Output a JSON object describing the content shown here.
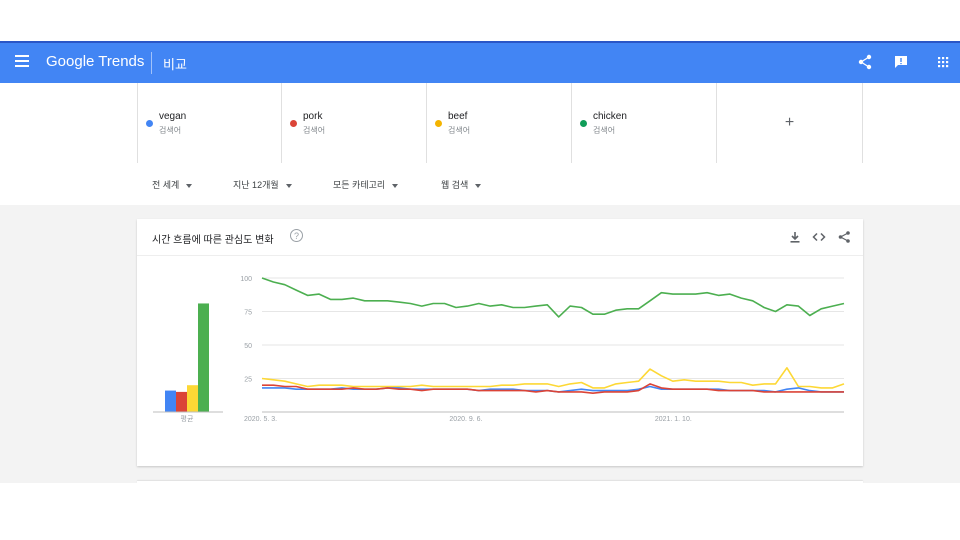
{
  "header": {
    "logo": "Google Trends",
    "title": "비교",
    "brand_color": "#4285f4",
    "icons": [
      "menu-icon",
      "share-icon",
      "feedback-icon",
      "apps-icon"
    ]
  },
  "terms": [
    {
      "name": "vegan",
      "type": "검색어",
      "color": "#4285f4"
    },
    {
      "name": "pork",
      "type": "검색어",
      "color": "#db4437"
    },
    {
      "name": "beef",
      "type": "검색어",
      "color": "#f4b400"
    },
    {
      "name": "chicken",
      "type": "검색어",
      "color": "#0f9d58"
    }
  ],
  "add_term": "+",
  "filters": {
    "region": "전 세계",
    "period": "지난 12개월",
    "category": "모든 카테고리",
    "search_type": "웹 검색"
  },
  "card": {
    "title": "시간 흐름에 따른 관심도 변화",
    "help": "?",
    "icons": [
      "download-icon",
      "embed-icon",
      "share-icon"
    ]
  },
  "chart_data": {
    "type": "line",
    "x_ticks": [
      "2020. 5. 3.",
      "2020. 9. 6.",
      "2021. 1. 10."
    ],
    "y_ticks": [
      "100",
      "75",
      "50",
      "25"
    ],
    "ylim": [
      0,
      100
    ],
    "grid": true,
    "average_label": "평균",
    "averages": [
      {
        "name": "vegan",
        "value": 16
      },
      {
        "name": "pork",
        "value": 15
      },
      {
        "name": "beef",
        "value": 20
      },
      {
        "name": "chicken",
        "value": 81
      }
    ],
    "series": [
      {
        "name": "chicken",
        "color": "#4caf50",
        "values": [
          100,
          97,
          95,
          91,
          87,
          88,
          84,
          84,
          85,
          83,
          83,
          83,
          82,
          81,
          79,
          81,
          81,
          78,
          79,
          81,
          79,
          80,
          78,
          78,
          79,
          80,
          71,
          79,
          78,
          73,
          73,
          76,
          77,
          77,
          83,
          89,
          88,
          88,
          88,
          89,
          87,
          88,
          85,
          83,
          78,
          75,
          80,
          79,
          72,
          77,
          79,
          81
        ]
      },
      {
        "name": "beef",
        "color": "#fdd835",
        "values": [
          25,
          24,
          23,
          21,
          19,
          20,
          20,
          20,
          19,
          19,
          19,
          19,
          19,
          19,
          20,
          19,
          19,
          19,
          19,
          19,
          19,
          20,
          20,
          21,
          21,
          21,
          19,
          21,
          22,
          18,
          18,
          21,
          22,
          23,
          32,
          27,
          23,
          24,
          23,
          23,
          23,
          22,
          22,
          20,
          21,
          21,
          33,
          19,
          19,
          18,
          18,
          21
        ]
      },
      {
        "name": "vegan",
        "color": "#4285f4",
        "values": [
          18,
          18,
          18,
          17,
          17,
          17,
          17,
          18,
          17,
          17,
          17,
          18,
          18,
          17,
          17,
          17,
          17,
          17,
          17,
          16,
          17,
          17,
          17,
          16,
          16,
          16,
          15,
          16,
          17,
          16,
          16,
          16,
          16,
          17,
          19,
          17,
          17,
          17,
          17,
          17,
          17,
          16,
          16,
          16,
          16,
          15,
          17,
          18,
          16,
          15,
          15,
          15
        ]
      },
      {
        "name": "pork",
        "color": "#db4437",
        "values": [
          20,
          20,
          19,
          19,
          17,
          17,
          17,
          17,
          18,
          17,
          17,
          18,
          17,
          17,
          16,
          17,
          17,
          17,
          17,
          16,
          16,
          16,
          16,
          16,
          15,
          16,
          15,
          15,
          15,
          14,
          15,
          15,
          15,
          16,
          21,
          18,
          17,
          17,
          17,
          17,
          16,
          16,
          16,
          16,
          15,
          15,
          15,
          15,
          15,
          15,
          15,
          15
        ]
      }
    ]
  }
}
